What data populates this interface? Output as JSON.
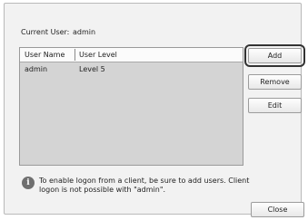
{
  "current_user": {
    "label": "Current User:",
    "value": "admin"
  },
  "table": {
    "columns": [
      "User Name",
      "User Level"
    ],
    "rows": [
      {
        "name": "admin",
        "level": "Level 5"
      }
    ]
  },
  "buttons": {
    "add": "Add",
    "remove": "Remove",
    "edit": "Edit",
    "close": "Close"
  },
  "info": {
    "icon": "info-icon",
    "text": "To enable logon from a client, be sure to add users. Client logon is not possible with \"admin\"."
  },
  "colors": {
    "list_background": "#d4d4d4",
    "dialog_background": "#f2f2f2",
    "info_icon": "#6f6f6f"
  }
}
